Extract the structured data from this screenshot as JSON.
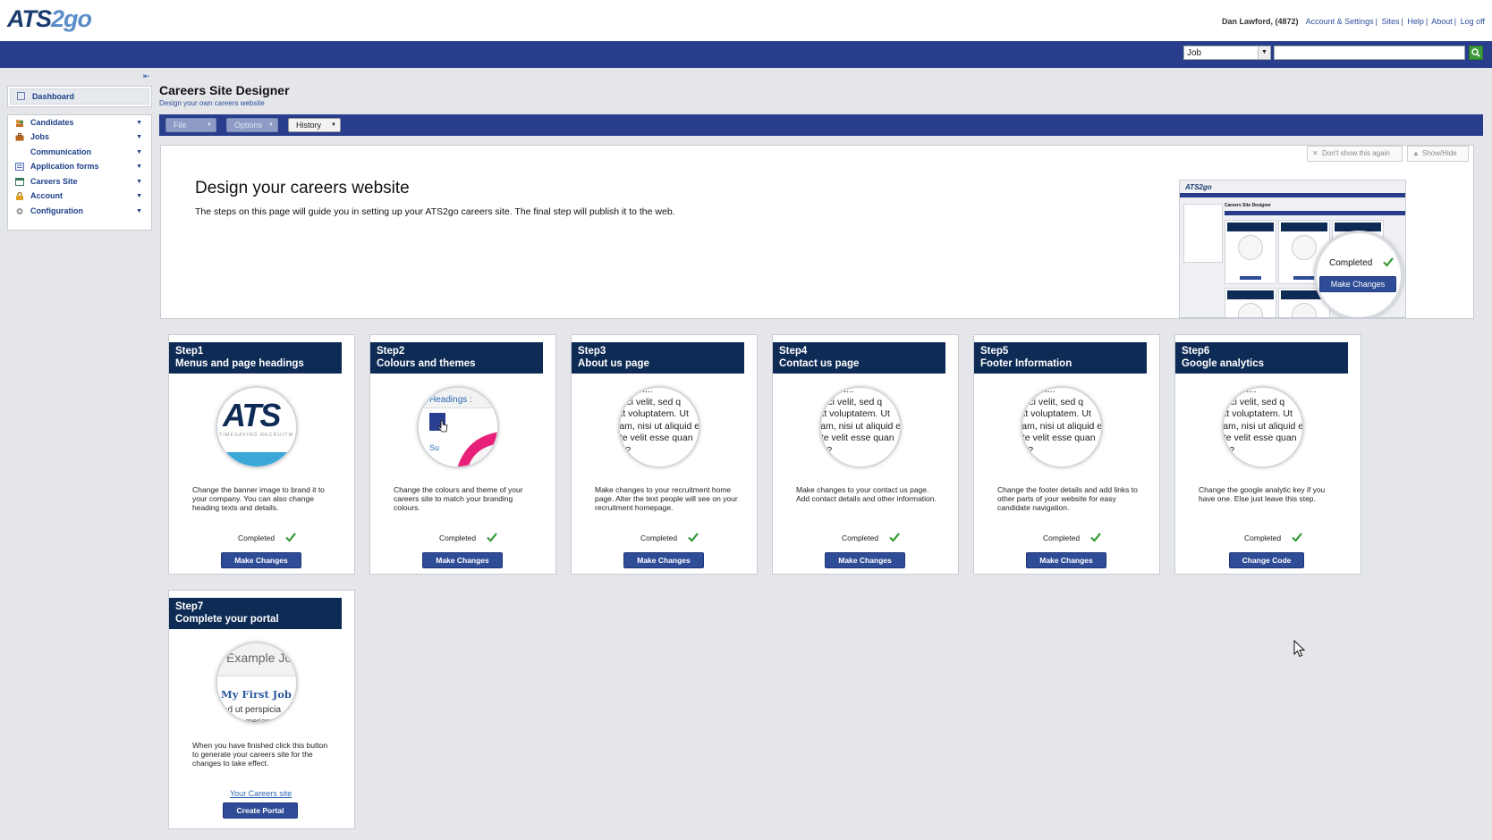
{
  "app": {
    "logo_main": "ATS",
    "logo_go": "2go",
    "user": "Dan Lawford, (4872)",
    "links": [
      "Account & Settings",
      "Sites",
      "Help",
      "About",
      "Log off"
    ]
  },
  "search": {
    "type_selected": "Job",
    "placeholder": ""
  },
  "sidebar": {
    "dashboard": "Dashboard",
    "items": [
      {
        "label": "Candidates",
        "icon": "candidates-icon"
      },
      {
        "label": "Jobs",
        "icon": "jobs-icon"
      },
      {
        "label": "Communication",
        "icon": ""
      },
      {
        "label": "Application forms",
        "icon": "forms-icon"
      },
      {
        "label": "Careers Site",
        "icon": "careers-site-icon"
      },
      {
        "label": "Account",
        "icon": "account-icon"
      },
      {
        "label": "Configuration",
        "icon": "configuration-icon"
      }
    ]
  },
  "page": {
    "title": "Careers Site Designer",
    "subtitle": "Design your own careers website"
  },
  "toolbar": {
    "file": "File",
    "options": "Options",
    "history": "History"
  },
  "info": {
    "dont_show": "Don't show this again",
    "show_hide": "Show/Hide",
    "title": "Design your careers website",
    "text": "The steps on this page will guide you in setting up your ATS2go careers site. The final step will publish it to the web.",
    "preview_completed": "Completed",
    "preview_button": "Make Changes"
  },
  "steps": [
    {
      "step": "Step1",
      "title": "Menus and page headings",
      "desc": "Change the banner image to brand it to your company. You can also change heading texts and details.",
      "status": "Completed",
      "button": "Make Changes"
    },
    {
      "step": "Step2",
      "title": "Colours and themes",
      "desc": "Change the colours and theme of your careers site to match your branding colours.",
      "status": "Completed",
      "button": "Make Changes"
    },
    {
      "step": "Step3",
      "title": "About us page",
      "desc": "Make changes to your recruitment home page. Alter the text people will see on your recruitment homepage.",
      "status": "Completed",
      "button": "Make Changes"
    },
    {
      "step": "Step4",
      "title": "Contact us page",
      "desc": "Make changes to your contact us page. Add contact details and other information.",
      "status": "Completed",
      "button": "Make Changes"
    },
    {
      "step": "Step5",
      "title": "Footer Information",
      "desc": "Change the footer details and add links to other parts of your website for easy candidate navigation.",
      "status": "Completed",
      "button": "Make Changes"
    },
    {
      "step": "Step6",
      "title": "Google analytics",
      "desc": "Change the google analytic key if you have one. Else just leave this step.",
      "status": "Completed",
      "button": "Change Code"
    },
    {
      "step": "Step7",
      "title": "Complete your portal",
      "desc": "When you have finished click this button to generate your careers site for the changes to take effect.",
      "link": "Your Careers site",
      "button": "Create Portal"
    }
  ],
  "circle_content": {
    "ats_brand": "ATS",
    "ats_tagline": "TIMESAVING RECRUITM",
    "headings_label": "Headings :",
    "su_label": "Su",
    "lorem": "...sequi...\npisci velit, sed q\nrat voluptatem. Ut\nsam, nisi ut aliquid e\nate velit esse quan\ntur?",
    "portal_example": "Example Jo",
    "portal_job": "My First Job",
    "portal_text": "ed ut perspicia",
    "portal_text2": "...meriam"
  },
  "colors": {
    "navbar": "#283d8c",
    "step_header": "#0e2b55",
    "button": "#2f4c96",
    "check": "#3a9a3a"
  }
}
